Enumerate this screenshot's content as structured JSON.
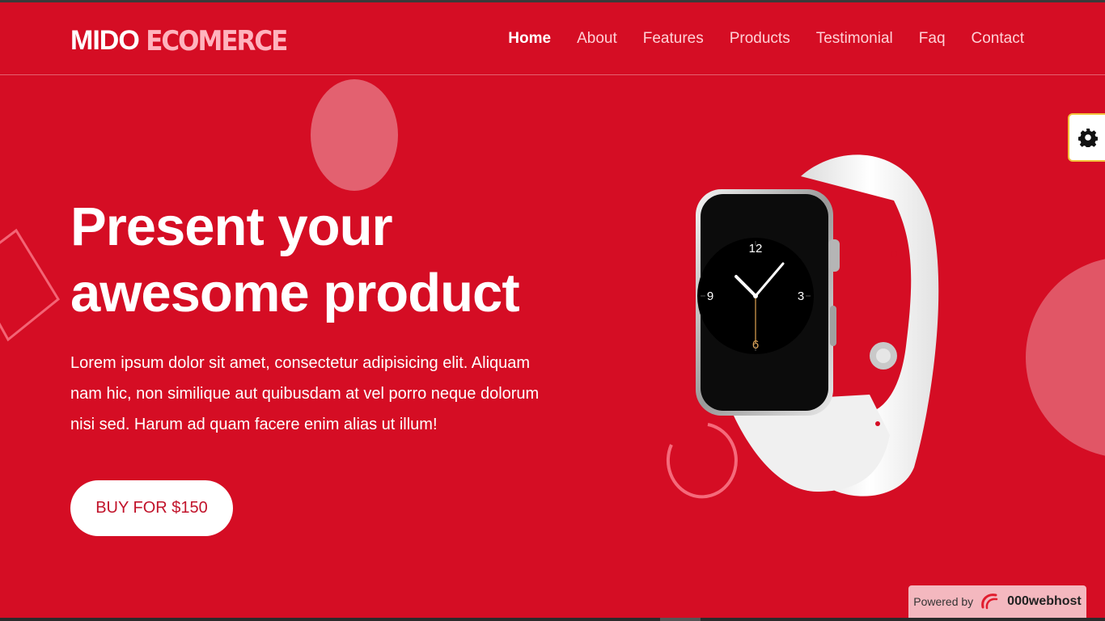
{
  "brand": {
    "part1": "MIDO",
    "part2": "ECOMERCE"
  },
  "nav": [
    {
      "label": "Home",
      "active": true
    },
    {
      "label": "About"
    },
    {
      "label": "Features"
    },
    {
      "label": "Products"
    },
    {
      "label": "Testimonial"
    },
    {
      "label": "Faq"
    },
    {
      "label": "Contact"
    }
  ],
  "hero": {
    "title_line1": "Present your",
    "title_line2": "awesome product",
    "text": "Lorem ipsum dolor sit amet, consectetur adipisicing elit. Aliquam nam hic, non similique aut quibusdam at vel porro neque dolorum nisi sed. Harum ad quam facere enim alias ut illum!",
    "button_label": "BUY FOR $150"
  },
  "watch_face": {
    "n12": "12",
    "n3": "3",
    "n6": "6",
    "n9": "9"
  },
  "footer_badge": {
    "powered_by": "Powered by",
    "host": "000webhost"
  },
  "colors": {
    "background": "#d50d24",
    "accent_light": "#ffb3bd",
    "button_text": "#c1132a"
  },
  "icons": {
    "settings": "gear-icon",
    "host_logo": "000webhost-logo-icon"
  }
}
